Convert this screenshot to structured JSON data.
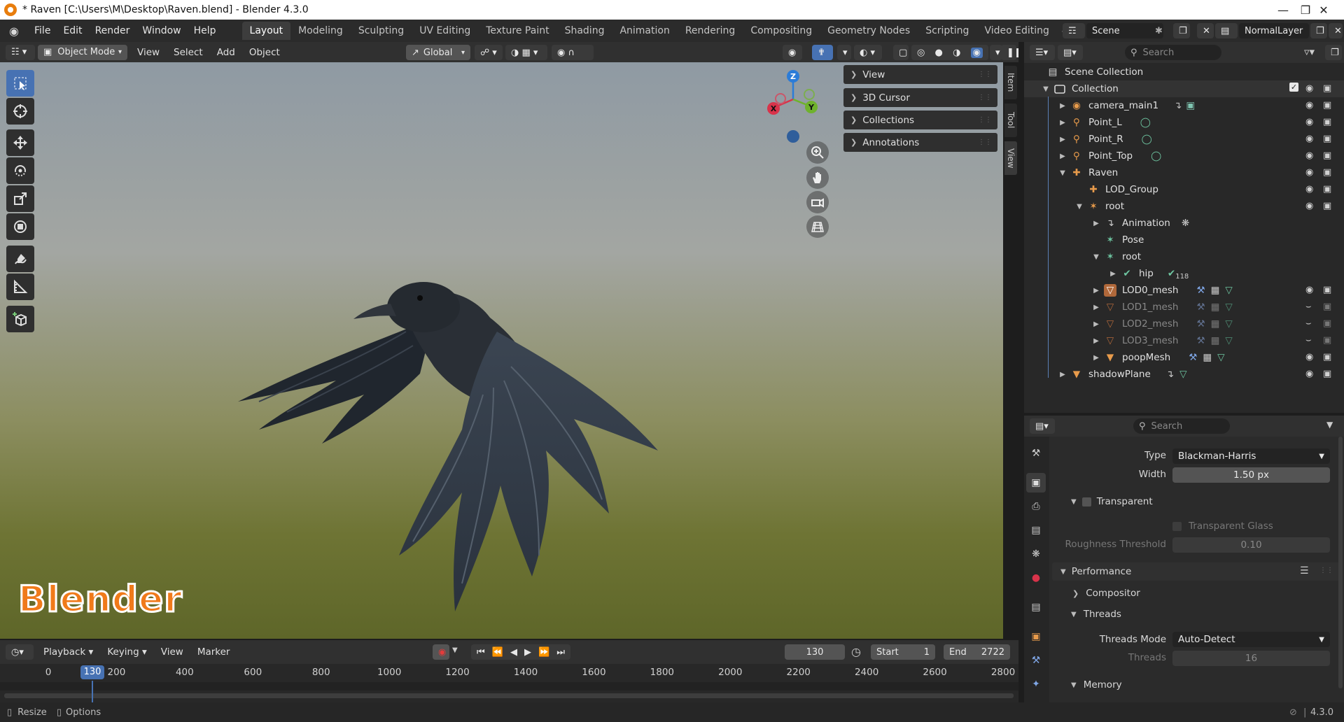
{
  "window": {
    "title": "* Raven [C:\\Users\\M\\Desktop\\Raven.blend] - Blender 4.3.0"
  },
  "topbar": {
    "menus": [
      "File",
      "Edit",
      "Render",
      "Window",
      "Help"
    ],
    "workspaces": [
      "Layout",
      "Modeling",
      "Sculpting",
      "UV Editing",
      "Texture Paint",
      "Shading",
      "Animation",
      "Rendering",
      "Compositing",
      "Geometry Nodes",
      "Scripting",
      "Video Editing"
    ],
    "scene": "Scene",
    "view_layer": "NormalLayer"
  },
  "viewport_header": {
    "mode": "Object Mode",
    "menus": [
      "View",
      "Select",
      "Add",
      "Object"
    ],
    "orientation": "Global"
  },
  "gizmo": {
    "z": "Z",
    "x": "X",
    "y": "Y"
  },
  "npanel": {
    "items": [
      "View",
      "3D Cursor",
      "Collections",
      "Annotations"
    ],
    "tabs": [
      "Item",
      "Tool",
      "View"
    ]
  },
  "overlay_text": "Blender",
  "outliner": {
    "search_placeholder": "Search",
    "scene_collection": "Scene Collection",
    "collection": "Collection",
    "items": [
      "camera_main1",
      "Point_L",
      "Point_R",
      "Point_Top",
      "Raven",
      "LOD_Group",
      "root",
      "Animation",
      "Pose",
      "root",
      "hip",
      "LOD0_mesh",
      "LOD1_mesh",
      "LOD2_mesh",
      "LOD3_mesh",
      "poopMesh",
      "shadowPlane"
    ],
    "hip_badge": "118"
  },
  "properties": {
    "search_placeholder": "Search",
    "type_label": "Type",
    "type_value": "Blackman-Harris",
    "width_label": "Width",
    "width_value": "1.50 px",
    "transparent": "Transparent",
    "transparent_glass": "Transparent Glass",
    "roughness_label": "Roughness Threshold",
    "roughness_value": "0.10",
    "performance": "Performance",
    "compositor": "Compositor",
    "threads": "Threads",
    "threads_mode_label": "Threads Mode",
    "threads_mode_value": "Auto-Detect",
    "threads_label": "Threads",
    "threads_value": "16",
    "memory": "Memory"
  },
  "timeline": {
    "menus": [
      "Playback",
      "Keying",
      "View",
      "Marker"
    ],
    "current_frame": "130",
    "start_label": "Start",
    "start": "1",
    "end_label": "End",
    "end": "2722",
    "ticks": [
      "0",
      "200",
      "400",
      "600",
      "800",
      "1000",
      "1200",
      "1400",
      "1600",
      "1800",
      "2000",
      "2200",
      "2400",
      "2600",
      "2800"
    ],
    "playhead": "130"
  },
  "statusbar": {
    "resize": "Resize",
    "options": "Options",
    "version": "4.3.0"
  },
  "colors": {
    "accent": "#4772b3",
    "bg": "#1d1d1d",
    "panel": "#303030",
    "logo_orange": "#f07a1a"
  }
}
